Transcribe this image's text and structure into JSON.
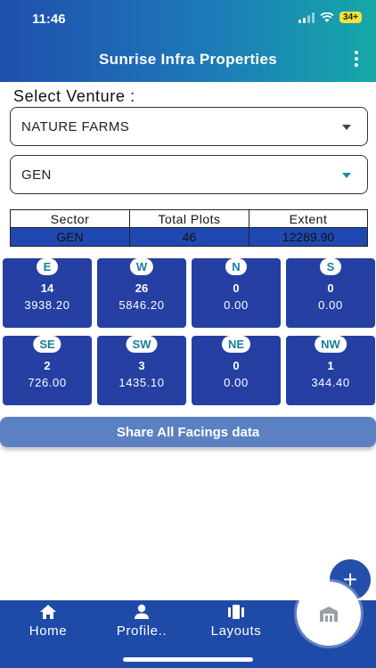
{
  "status_bar": {
    "time": "11:46",
    "battery": "34+"
  },
  "app_bar": {
    "title": "Sunrise Infra Properties"
  },
  "venture": {
    "label": "Select Venture :",
    "selected": "NATURE FARMS",
    "sector_selected": "GEN"
  },
  "summary": {
    "headers": [
      "Sector",
      "Total Plots",
      "Extent"
    ],
    "row": [
      "GEN",
      "46",
      "12289.90"
    ]
  },
  "facings": [
    {
      "dir": "E",
      "count": "14",
      "extent": "3938.20"
    },
    {
      "dir": "W",
      "count": "26",
      "extent": "5846.20"
    },
    {
      "dir": "N",
      "count": "0",
      "extent": "0.00"
    },
    {
      "dir": "S",
      "count": "0",
      "extent": "0.00"
    },
    {
      "dir": "SE",
      "count": "2",
      "extent": "726.00"
    },
    {
      "dir": "SW",
      "count": "3",
      "extent": "1435.10"
    },
    {
      "dir": "NE",
      "count": "0",
      "extent": "0.00"
    },
    {
      "dir": "NW",
      "count": "1",
      "extent": "344.40"
    }
  ],
  "share_button": "Share All Facings data",
  "fab_add": "+",
  "bottom_nav": [
    {
      "label": "Home",
      "icon": "home-icon"
    },
    {
      "label": "Profile..",
      "icon": "person-icon"
    },
    {
      "label": "Layouts",
      "icon": "layouts-icon"
    }
  ],
  "colors": {
    "primary": "#1e4aa8",
    "card": "#253fa3",
    "accent_teal": "#17809a",
    "share": "#5b81c2"
  }
}
